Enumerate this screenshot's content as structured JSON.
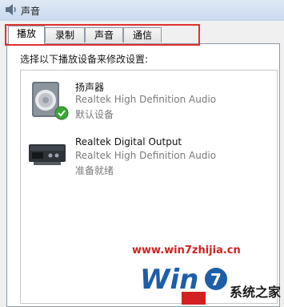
{
  "window": {
    "title": "声音",
    "icon": "speaker-icon"
  },
  "tabs": [
    {
      "label": "播放",
      "active": true
    },
    {
      "label": "录制",
      "active": false
    },
    {
      "label": "声音",
      "active": false
    },
    {
      "label": "通信",
      "active": false
    }
  ],
  "panel": {
    "instruction": "选择以下播放设备来修改设置:",
    "devices": [
      {
        "name": "扬声器",
        "description": "Realtek High Definition Audio",
        "status": "默认设备",
        "icon": "speaker-device-icon",
        "default": true
      },
      {
        "name": "Realtek Digital Output",
        "description": "Realtek High Definition Audio",
        "status": "准备就绪",
        "icon": "digital-output-icon",
        "default": false
      }
    ]
  },
  "watermark": {
    "url": "www.win7zhijia.cn",
    "logo_text": "Win7系统之家",
    "brand_text": "系统之家"
  },
  "colors": {
    "highlight": "#e0312f",
    "watermark_red": "#d32020",
    "check_green": "#3aa635"
  }
}
